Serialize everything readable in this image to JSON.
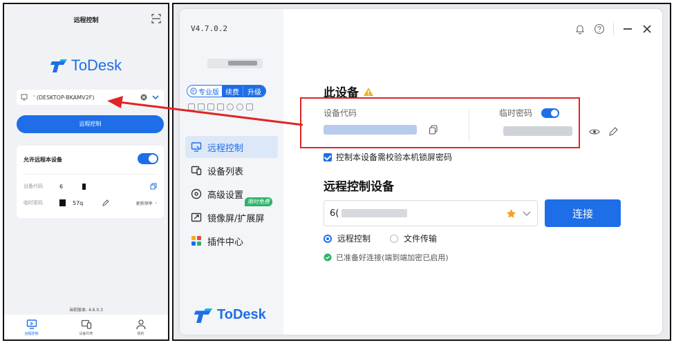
{
  "mobile": {
    "title": "远程控制",
    "logo_text": "ToDesk",
    "device_text": "' (DESKTOP-BKAMV2F)",
    "connect_label": "远程控制",
    "allow_label": "允许远程本设备",
    "device_code_label": "设备代码",
    "device_code_value": "6",
    "temp_password_label": "临时密码",
    "temp_password_value": "57q",
    "refresh_label": "更新频率",
    "version": "当前版本: 4.6.0.3",
    "nav": [
      {
        "label": "远程控制"
      },
      {
        "label": "设备列表"
      },
      {
        "label": "我的"
      }
    ]
  },
  "desktop": {
    "version": "V4.7.0.2",
    "plan": {
      "pro": "专业版",
      "renew": "续费",
      "upgrade": "升级"
    },
    "nav": [
      {
        "label": "远程控制",
        "icon": "monitor-icon"
      },
      {
        "label": "设备列表",
        "icon": "devices-icon"
      },
      {
        "label": "高级设置",
        "icon": "settings-icon"
      },
      {
        "label": "镜像屏/扩展屏",
        "icon": "mirror-screen-icon"
      },
      {
        "label": "插件中心",
        "icon": "plugin-icon"
      }
    ],
    "free_badge": "限时免费",
    "logo_text": "ToDesk",
    "this_device_title": "此设备",
    "device_code_label": "设备代码",
    "temp_password_label": "临时密码",
    "lock_check_label": "控制本设备需校验本机锁屏密码",
    "remote_title": "远程控制设备",
    "remote_input_value": "6(",
    "connect_label": "连接",
    "mode_remote": "远程控制",
    "mode_file": "文件传输",
    "status": "已准备好连接(端到端加密已启用)"
  },
  "colors": {
    "brand": "#1e6ee8",
    "highlight": "#e02424",
    "success": "#2db36b",
    "warning": "#f2b01e"
  }
}
